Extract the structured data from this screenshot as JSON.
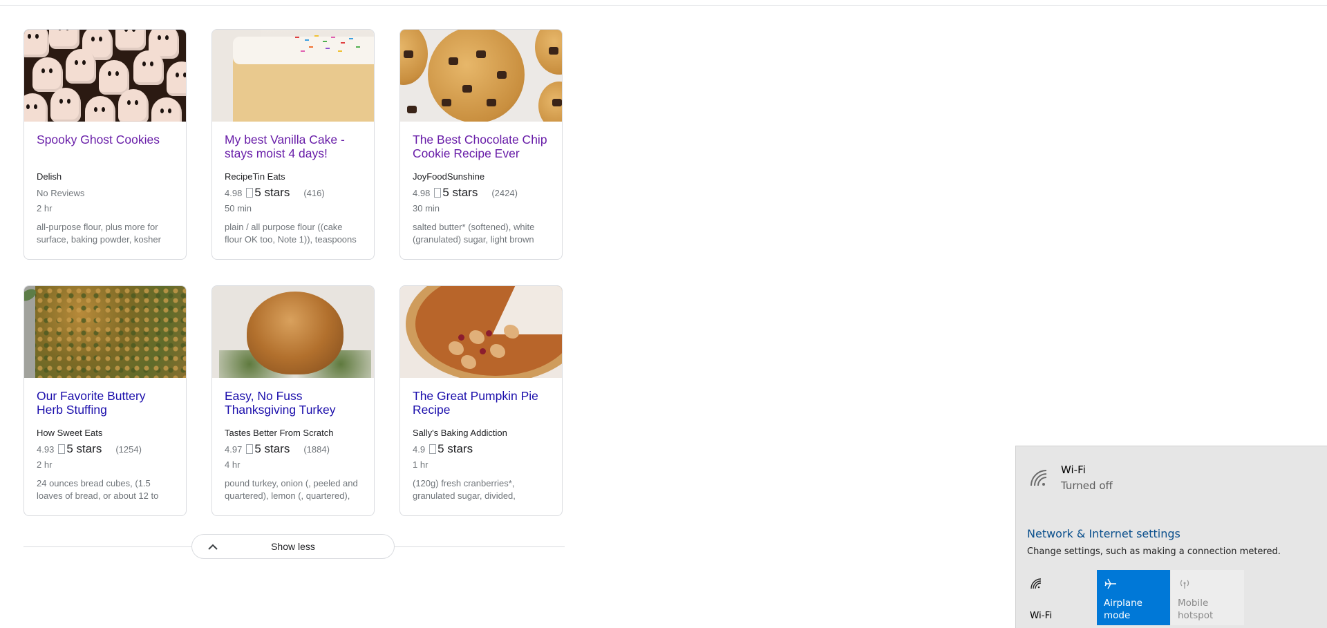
{
  "recipes": [
    {
      "title": "Spooky Ghost Cookies",
      "source": "Delish",
      "rating_text": "No Reviews",
      "time": "2 hr",
      "ingredients": "all-purpose flour, plus more for surface, baking powder, kosher",
      "image": "ghost-cookies-image",
      "visited": true
    },
    {
      "title": "My best Vanilla Cake - stays moist 4 days!",
      "source": "RecipeTin Eats",
      "rating": "4.98",
      "stars_alt": "5 stars",
      "count": "(416)",
      "time": "50 min",
      "ingredients": "plain / all purpose flour ((cake flour OK too, Note 1)), teaspoons",
      "image": "vanilla-cake-image",
      "visited": true
    },
    {
      "title": "The Best Chocolate Chip Cookie Recipe Ever",
      "source": "JoyFoodSunshine",
      "rating": "4.98",
      "stars_alt": "5 stars",
      "count": "(2424)",
      "time": "30 min",
      "ingredients": "salted butter* (softened), white (granulated) sugar, light brown",
      "image": "chocolate-chip-cookie-image",
      "visited": true
    },
    {
      "title": "Our Favorite Buttery Herb Stuffing",
      "source": "How Sweet Eats",
      "rating": "4.93",
      "stars_alt": "5 stars",
      "count": "(1254)",
      "time": "2 hr",
      "ingredients": "24 ounces bread cubes, (1.5 loaves of bread, or about 12 to",
      "image": "herb-stuffing-image",
      "visited": false
    },
    {
      "title": "Easy, No Fuss Thanksgiving Turkey",
      "source": "Tastes Better From Scratch",
      "rating": "4.97",
      "stars_alt": "5 stars",
      "count": "(1884)",
      "time": "4 hr",
      "ingredients": "pound turkey, onion (, peeled and quartered), lemon (, quartered),",
      "image": "roast-turkey-image",
      "visited": false
    },
    {
      "title": "The Great Pumpkin Pie Recipe",
      "source": "Sally's Baking Addiction",
      "rating": "4.9",
      "stars_alt": "5 stars",
      "count": "",
      "time": "1 hr",
      "ingredients": "(120g) fresh cranberries*, granulated sugar, divided,",
      "image": "pumpkin-pie-image",
      "visited": false
    }
  ],
  "show_less": {
    "label": "Show less",
    "icon": "chevron-up-icon"
  },
  "network_flyout": {
    "wifi": {
      "name": "Wi-Fi",
      "status": "Turned off",
      "icon": "wifi-icon"
    },
    "settings_link": "Network & Internet settings",
    "settings_desc": "Change settings, such as making a connection metered.",
    "tiles": [
      {
        "label": "Wi-Fi",
        "icon": "wifi-icon",
        "state": "off"
      },
      {
        "label": "Airplane mode",
        "icon": "airplane-icon",
        "state": "on"
      },
      {
        "label": "Mobile hotspot",
        "icon": "hotspot-icon",
        "state": "disabled"
      }
    ]
  },
  "colors": {
    "link": "#1a0dab",
    "visited_link": "#681da8",
    "accent_tile": "#0078d7",
    "settings_link": "#0a4f8c"
  }
}
